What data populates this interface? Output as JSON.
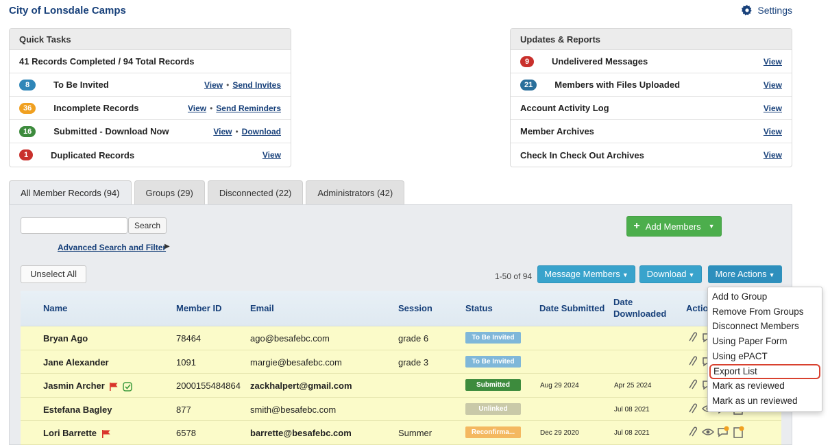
{
  "app": {
    "title": "City of Lonsdale Camps",
    "settings_label": "Settings"
  },
  "quick_tasks": {
    "title": "Quick Tasks",
    "summary": "41 Records Completed / 94 Total Records",
    "rows": [
      {
        "count": "8",
        "color": "#2f86b8",
        "label": "To Be Invited",
        "link1": "View",
        "link2": "Send Invites"
      },
      {
        "count": "36",
        "color": "#f0a020",
        "label": "Incomplete Records",
        "link1": "View",
        "link2": "Send Reminders"
      },
      {
        "count": "16",
        "color": "#3d8b3d",
        "label": "Submitted - Download Now",
        "link1": "View",
        "link2": "Download"
      },
      {
        "count": "1",
        "color": "#c9302c",
        "label": "Duplicated Records",
        "link1": "View",
        "link2": ""
      }
    ]
  },
  "updates": {
    "title": "Updates & Reports",
    "rows": [
      {
        "count": "9",
        "color": "#c9302c",
        "label": "Undelivered Messages",
        "link": "View"
      },
      {
        "count": "21",
        "color": "#2a6f9b",
        "label": "Members with Files Uploaded",
        "link": "View"
      },
      {
        "count": "",
        "label": "Account Activity Log",
        "link": "View"
      },
      {
        "count": "",
        "label": "Member Archives",
        "link": "View"
      },
      {
        "count": "",
        "label": "Check In Check Out Archives",
        "link": "View"
      }
    ]
  },
  "tabs": [
    "All Member Records (94)",
    "Groups (29)",
    "Disconnected (22)",
    "Administrators (42)"
  ],
  "toolbar": {
    "search_placeholder": "",
    "search_label": "Search",
    "advanced_search": "Advanced Search and Filter",
    "add_members": "Add Members",
    "unselect_all": "Unselect All",
    "pager": "1-50 of 94",
    "message_members": "Message Members",
    "download": "Download",
    "more_actions": "More Actions"
  },
  "table": {
    "headers": {
      "name": "Name",
      "member_id": "Member ID",
      "email": "Email",
      "session": "Session",
      "status": "Status",
      "date_submitted": "Date Submitted",
      "date_downloaded": "Date Downloaded",
      "actions": "Actio"
    },
    "rows": [
      {
        "name": "Bryan Ago",
        "id": "78464",
        "email": "ago@besafebc.com",
        "session": "grade 6",
        "status": "To Be Invited",
        "status_color": "#7fb7d9",
        "submitted": "",
        "downloaded": ""
      },
      {
        "name": "Jane Alexander",
        "id": "1091",
        "email": "margie@besafebc.com",
        "session": "grade 3",
        "status": "To Be Invited",
        "status_color": "#7fb7d9",
        "submitted": "",
        "downloaded": ""
      },
      {
        "name": "Jasmin Archer",
        "id": "2000155484864",
        "email": "zackhalpert@gmail.com",
        "session": "",
        "status": "Submitted",
        "status_color": "#3d8b3d",
        "submitted": "Aug 29 2024",
        "downloaded": "Apr 25 2024"
      },
      {
        "name": "Estefana Bagley",
        "id": "877",
        "email": "smith@besafebc.com",
        "session": "",
        "status": "Unlinked",
        "status_color": "#c9c9a8",
        "submitted": "",
        "downloaded": "Jul 08 2021"
      },
      {
        "name": "Lori Barrette",
        "id": "6578",
        "email": "barrette@besafebc.com",
        "session": "Summer",
        "status": "Reconfirma...",
        "status_color": "#f4b860",
        "submitted": "Dec 29 2020",
        "downloaded": "Jul 08 2021"
      }
    ]
  },
  "more_actions_menu": [
    "Add to Group",
    "Remove From Groups",
    "Disconnect Members",
    "Using Paper Form",
    "Using ePACT",
    "Export List",
    "Mark as reviewed",
    "Mark as un reviewed"
  ],
  "highlighted_menu_item": "Export List",
  "icons": [
    "gear-icon",
    "plus-icon",
    "caret-down-icon",
    "flag-icon",
    "check-circle-icon",
    "paperclip-icon",
    "eye-icon",
    "comment-icon",
    "clipboard-icon",
    "triangle-right-icon"
  ]
}
